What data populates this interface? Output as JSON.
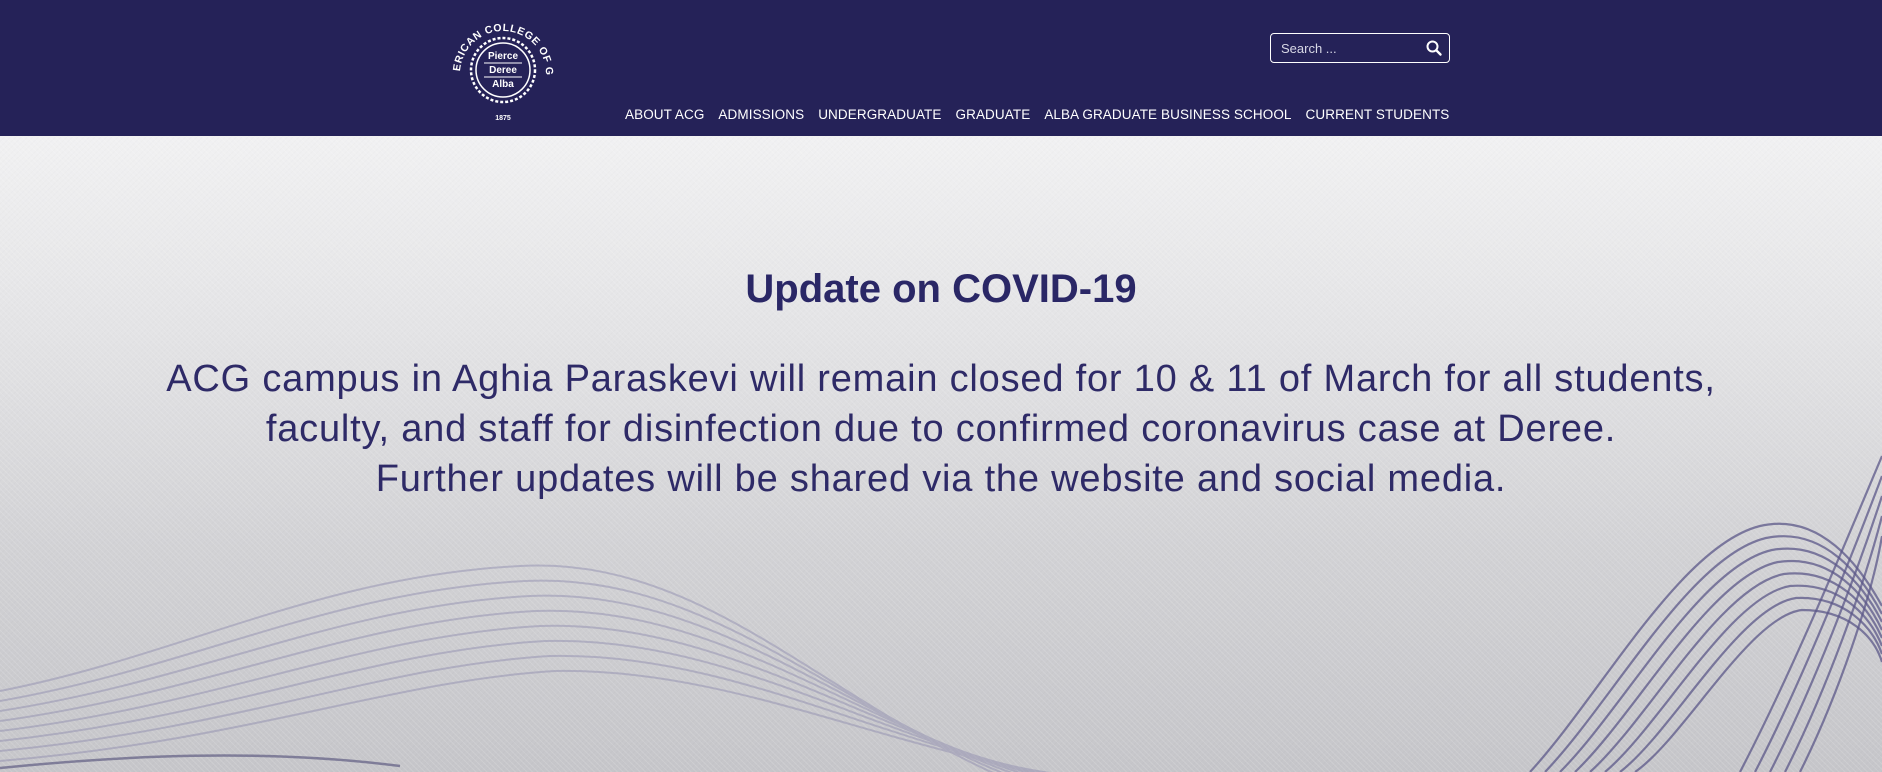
{
  "header": {
    "logo": {
      "arc_text": "THE AMERICAN COLLEGE OF GREECE",
      "line1": "Pierce",
      "line2": "Deree",
      "line3": "Alba",
      "year": "1875"
    },
    "search": {
      "placeholder": "Search ...",
      "icon": "search-icon"
    },
    "nav": [
      {
        "label": "ABOUT ACG"
      },
      {
        "label": "ADMISSIONS"
      },
      {
        "label": "UNDERGRADUATE"
      },
      {
        "label": "GRADUATE"
      },
      {
        "label": "ALBA GRADUATE BUSINESS SCHOOL"
      },
      {
        "label": "CURRENT STUDENTS"
      }
    ]
  },
  "hero": {
    "title": "Update on COVID-19",
    "lines": [
      "ACG campus in Aghia Paraskevi will remain closed for 10 & 11 of March for all students,",
      "faculty, and staff for disinfection due to confirmed coronavirus case at Deree.",
      "Further updates will be shared via the website and social media."
    ]
  },
  "colors": {
    "brand_navy": "#252258",
    "text_navy": "#2a2766",
    "white": "#ffffff"
  }
}
